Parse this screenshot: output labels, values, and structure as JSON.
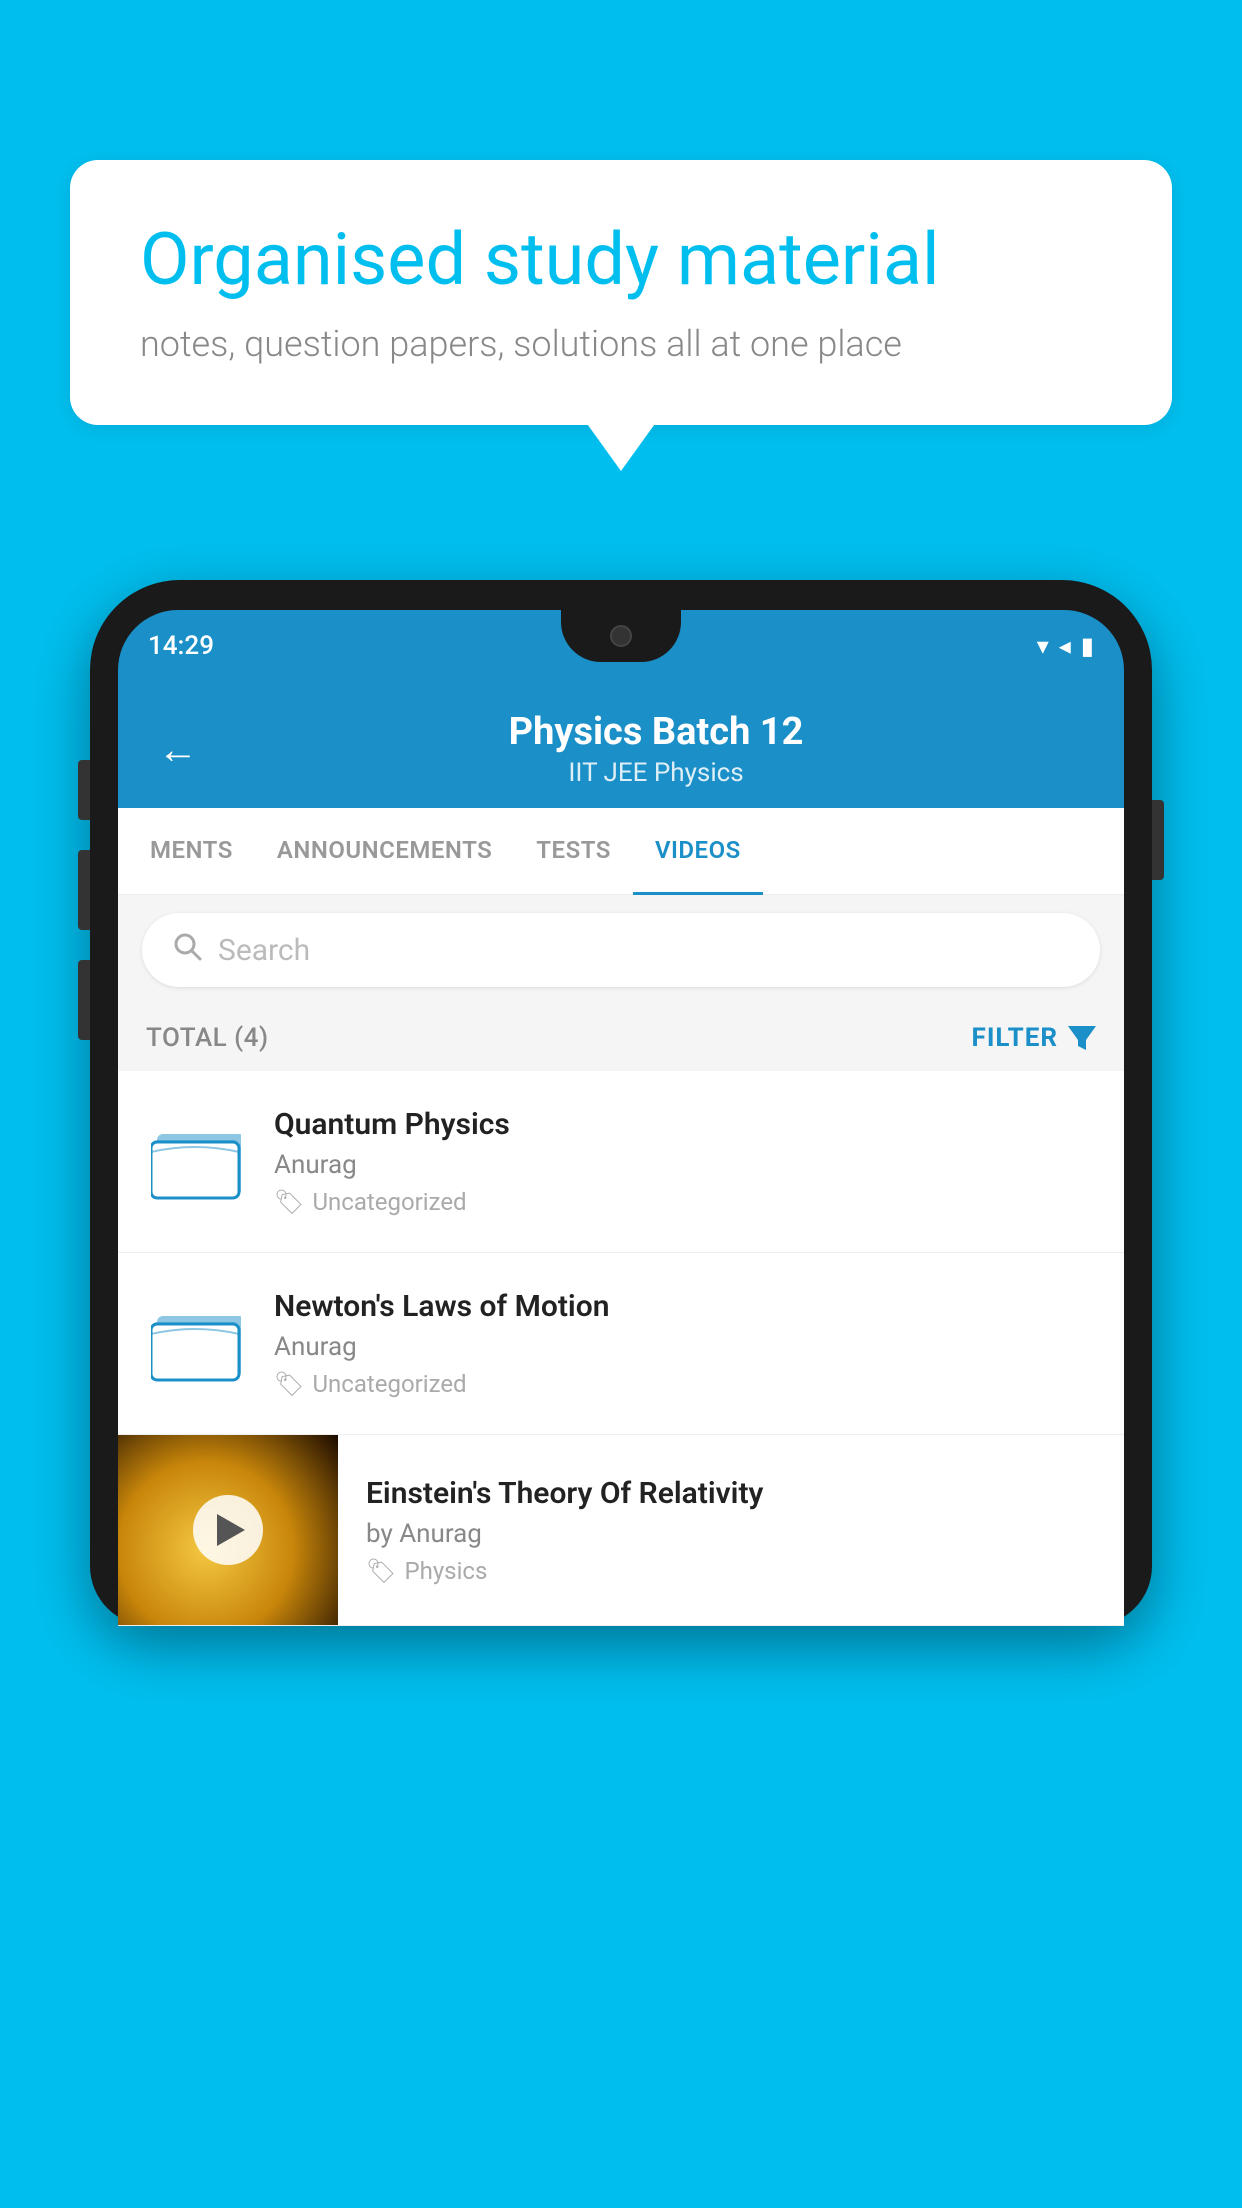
{
  "background_color": "#00BFEF",
  "speech_bubble": {
    "heading": "Organised study material",
    "subtext": "notes, question papers, solutions all at one place"
  },
  "phone": {
    "status_bar": {
      "time": "14:29",
      "icons": "▾◂▮"
    },
    "app_header": {
      "title": "Physics Batch 12",
      "subtitle": "IIT JEE   Physics",
      "back_label": "←"
    },
    "tabs": [
      {
        "label": "MENTS",
        "active": false
      },
      {
        "label": "ANNOUNCEMENTS",
        "active": false
      },
      {
        "label": "TESTS",
        "active": false
      },
      {
        "label": "VIDEOS",
        "active": true
      }
    ],
    "search": {
      "placeholder": "Search"
    },
    "filter_bar": {
      "total_label": "TOTAL (4)",
      "filter_label": "FILTER"
    },
    "videos": [
      {
        "type": "folder",
        "title": "Quantum Physics",
        "author": "Anurag",
        "tag": "Uncategorized"
      },
      {
        "type": "folder",
        "title": "Newton's Laws of Motion",
        "author": "Anurag",
        "tag": "Uncategorized"
      },
      {
        "type": "thumbnail",
        "title": "Einstein's Theory Of Relativity",
        "author": "by Anurag",
        "tag": "Physics"
      }
    ]
  }
}
